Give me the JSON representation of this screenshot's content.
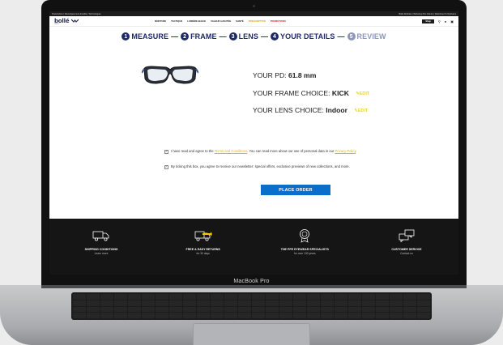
{
  "device": {
    "label": "MacBook Pro"
  },
  "topbar": {
    "left": "Prescription | Développement durable | Technologies",
    "right": "Bollé Website | Webshop Pro Clients | Webshop Kit Opticians"
  },
  "nav": {
    "logo": "bollé",
    "logo_sub": "SAFETY",
    "items": [
      {
        "label": "MONTURE"
      },
      {
        "label": "TACTIQUE"
      },
      {
        "label": "LUMIÈRE BLEUE"
      },
      {
        "label": "VALEUR AJOUTÉE"
      },
      {
        "label": "SANTÉ"
      },
      {
        "label": "PRESCRIPTION"
      },
      {
        "label": "PROMOTIONS"
      }
    ],
    "shop_label": "Shop"
  },
  "steps": [
    {
      "num": "1",
      "label": "MEASURE"
    },
    {
      "num": "2",
      "label": "FRAME"
    },
    {
      "num": "3",
      "label": "LENS"
    },
    {
      "num": "4",
      "label": "YOUR DETAILS"
    },
    {
      "num": "5",
      "label": "REVIEW"
    }
  ],
  "summary": {
    "pd_label": "YOUR PD: ",
    "pd_value": "61.8 mm",
    "frame_label": "YOUR FRAME CHOICE: ",
    "frame_value": "KICK",
    "lens_label": "YOUR LENS CHOICE: ",
    "lens_value": "Indoor",
    "edit_label": "EDIT"
  },
  "consent": {
    "terms_text_1": "I have read and agree to the ",
    "terms_link": "Terms and Conditions",
    "terms_text_2": ". You can read more about our use of personal data in our ",
    "privacy_link": "Privacy Policy",
    "terms_text_3": ".",
    "newsletter_text": "By ticking this box, you agree to receive our newsletter: special offers, exclusive previews of new collections, and more."
  },
  "order_button": "PLACE ORDER",
  "footer": [
    {
      "title": "SHIPPING CONDITIONS",
      "sub": "Learn more",
      "icon": "truck-icon"
    },
    {
      "title": "FREE & EASY RETURNS",
      "sub": "for 30 days",
      "icon": "return-truck-icon"
    },
    {
      "title": "THE PPE EYEWEAR SPECIALISTS",
      "sub": "for over 130 years",
      "icon": "medal-icon"
    },
    {
      "title": "CUSTOMER SERVICE",
      "sub": "Contact us",
      "icon": "chat-icon"
    }
  ],
  "colors": {
    "brand_navy": "#1e2a63",
    "step_inactive": "#8d96bd",
    "edit_yellow": "#e8c000",
    "order_blue": "#0a6ecb",
    "promo_red": "#e2122b"
  }
}
